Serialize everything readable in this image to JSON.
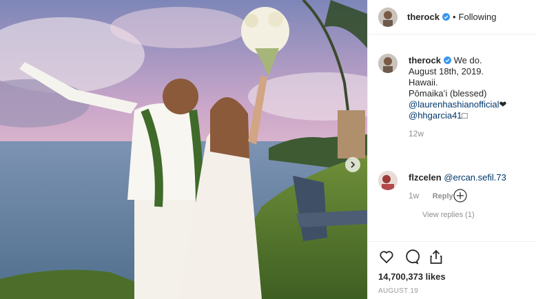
{
  "header": {
    "username": "therock",
    "separator": "•",
    "follow_status": "Following"
  },
  "caption": {
    "username": "therock",
    "lines": [
      "We do.",
      "August 18th, 2019.",
      "Hawaii.",
      "Pōmaikaʻi (blessed)"
    ],
    "mention1": "@laurenhashianofficial",
    "mention1_suffix": "❤",
    "mention2": "@hhgarcia41",
    "mention2_suffix": "□",
    "age": "12w"
  },
  "comment": {
    "username": "flzcelen",
    "mention": "@ercan.sefil.73",
    "age": "1w",
    "reply_label": "Reply",
    "view_replies": "View replies (1)"
  },
  "actions": {
    "like_icon": "heart-icon",
    "comment_icon": "comment-icon",
    "share_icon": "share-icon"
  },
  "likes": "14,700,373 likes",
  "post_date": "AUGUST 19",
  "colors": {
    "verified": "#3897f0",
    "link": "#00376b",
    "muted": "#8e8e8e"
  }
}
